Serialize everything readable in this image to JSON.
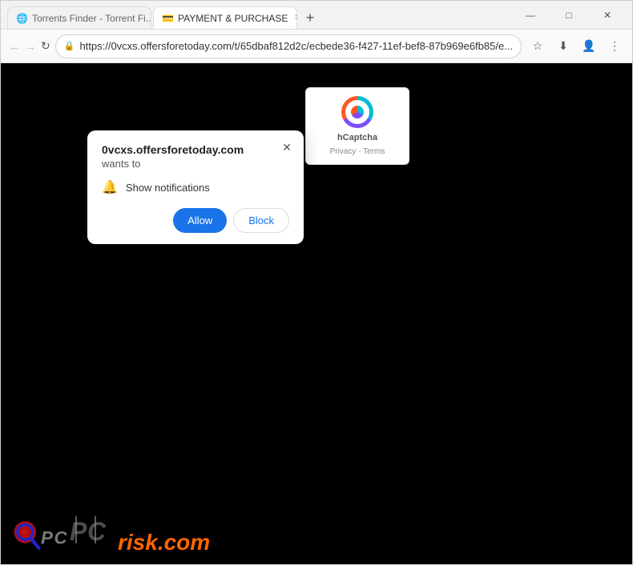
{
  "browser": {
    "tabs": [
      {
        "id": "tab1",
        "label": "Torrents Finder - Torrent Fi...",
        "favicon": "🌐",
        "active": false
      },
      {
        "id": "tab2",
        "label": "PAYMENT & PURCHASE",
        "favicon": "💳",
        "active": true
      }
    ],
    "new_tab_label": "+",
    "controls": {
      "minimize": "—",
      "maximize": "□",
      "close": "✕"
    },
    "nav": {
      "back": "←",
      "forward": "→",
      "reload": "↻"
    },
    "address": "https://0vcxs.offersforetoday.com/t/65dbaf812d2c/ecbede36-f427-11ef-bef8-87b969e6fb85/e...",
    "address_icons": {
      "star": "☆",
      "download": "⬇",
      "profile": "👤",
      "menu": "⋮"
    }
  },
  "popup": {
    "site": "0vcxs.offersforetoday.com",
    "wants_text": "wants to",
    "notification_text": "Show notifications",
    "allow_label": "Allow",
    "block_label": "Block",
    "close_label": "✕"
  },
  "hcaptcha": {
    "label": "hCaptcha",
    "links": "Privacy · Terms"
  },
  "pcrisk": {
    "prefix": "PC",
    "suffix": "risk.com"
  }
}
